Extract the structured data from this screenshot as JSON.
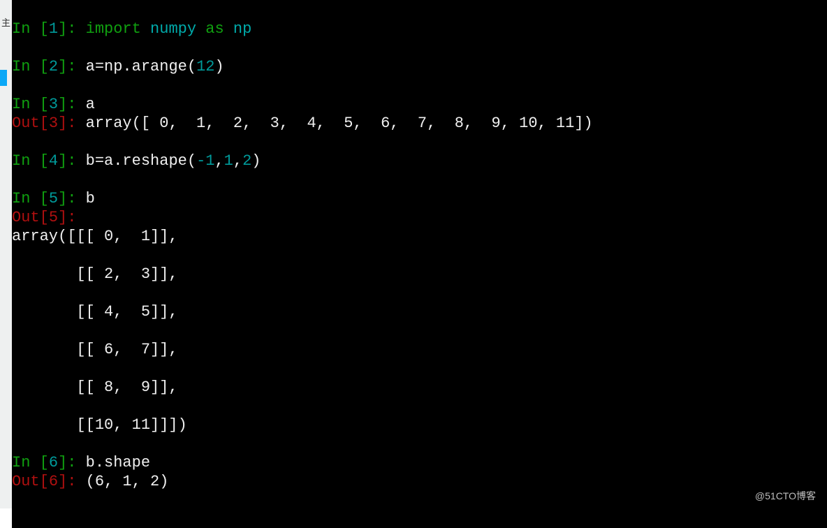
{
  "sidebar_char": "主",
  "watermark": "@51CTO博客",
  "cells": [
    {
      "in_n": "1",
      "in_html": "<span class='kw'>import</span> <span class='mod'>numpy</span> <span class='kw'>as</span> <span class='mod'>np</span>"
    },
    {
      "in_n": "2",
      "in_html": "<span class='txt'>a=np.arange(</span><span class='num'>12</span><span class='txt'>)</span>"
    },
    {
      "in_n": "3",
      "in_html": "<span class='txt'>a</span>",
      "out_n": "3",
      "out_inline": "<span class='txt'>array([ 0,  1,  2,  3,  4,  5,  6,  7,  8,  9, 10, 11])</span>"
    },
    {
      "in_n": "4",
      "in_html": "<span class='txt'>b=a.reshape(</span><span class='num'>-1</span><span class='txt'>,</span><span class='num'>1</span><span class='txt'>,</span><span class='num'>2</span><span class='txt'>)</span>"
    },
    {
      "in_n": "5",
      "in_html": "<span class='txt'>b</span>",
      "out_n": "5",
      "out_block": "array([[[ 0,  1]],\n\n       [[ 2,  3]],\n\n       [[ 4,  5]],\n\n       [[ 6,  7]],\n\n       [[ 8,  9]],\n\n       [[10, 11]]])"
    },
    {
      "in_n": "6",
      "in_html": "<span class='txt'>b.shape</span>",
      "out_n": "6",
      "out_inline": "<span class='txt'>(6, 1, 2)</span>"
    }
  ]
}
